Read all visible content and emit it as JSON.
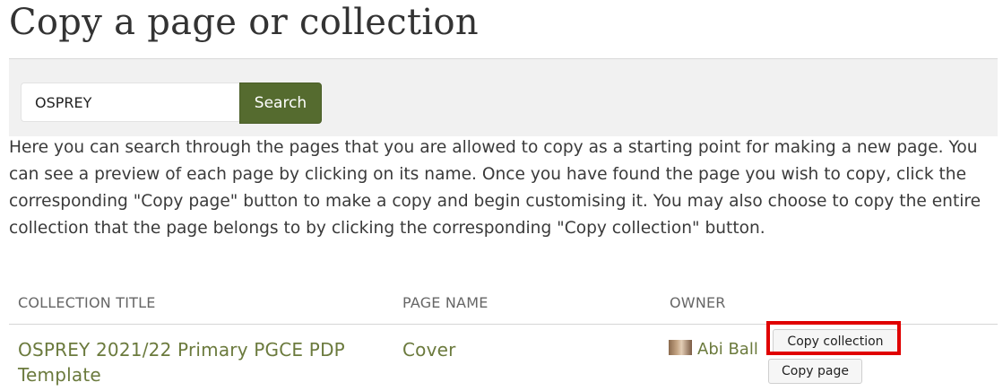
{
  "page": {
    "title": "Copy a page or collection"
  },
  "search": {
    "value": "OSPREY",
    "button_label": "Search"
  },
  "intro_text": "Here you can search through the pages that you are allowed to copy as a starting point for making a new page. You can see a preview of each page by clicking on its name. Once you have found the page you wish to copy, click the corresponding \"Copy page\" button to make a copy and begin customising it. You may also choose to copy the entire collection that the page belongs to by clicking the corresponding \"Copy collection\" button.",
  "table": {
    "headers": [
      "COLLECTION TITLE",
      "PAGE NAME",
      "OWNER"
    ],
    "rows": [
      {
        "collection_title": "OSPREY 2021/22 Primary PGCE PDP Template",
        "page_name": "Cover",
        "owner": "Abi Ball",
        "copy_collection_label": "Copy collection",
        "copy_page_label": "Copy page"
      }
    ]
  },
  "colors": {
    "search_button": "#556b2f",
    "link": "#6b7a3d",
    "highlight": "#e00000"
  }
}
